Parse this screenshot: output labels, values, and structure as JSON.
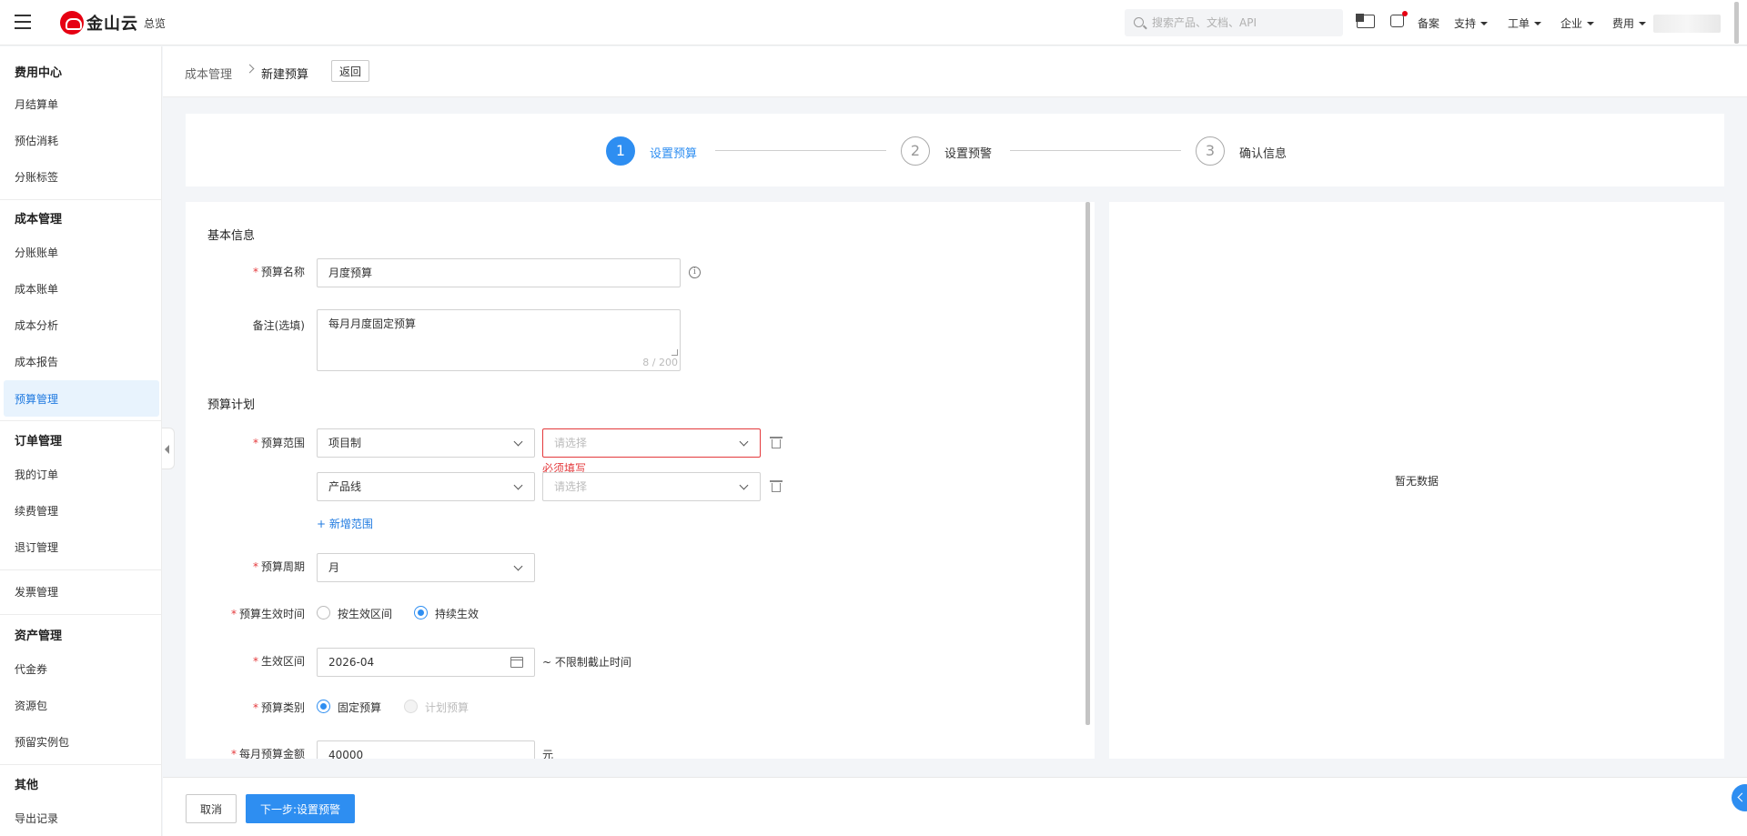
{
  "topbar": {
    "brand": "金山云",
    "overview": "总览",
    "search_placeholder": "搜索产品、文档、API",
    "nav": {
      "filing": "备案",
      "support": "支持",
      "ticket": "工单",
      "enterprise": "企业",
      "billing": "费用"
    }
  },
  "sidebar": {
    "groups": [
      {
        "title": "费用中心",
        "items": [
          "月结算单",
          "预估消耗",
          "分账标签"
        ]
      },
      {
        "title": "成本管理",
        "items": [
          "分账账单",
          "成本账单",
          "成本分析",
          "成本报告",
          "预算管理"
        ]
      },
      {
        "title": "订单管理",
        "items": [
          "我的订单",
          "续费管理",
          "退订管理"
        ]
      },
      {
        "title": "",
        "items": [
          "发票管理"
        ]
      },
      {
        "title": "资产管理",
        "items": [
          "代金券",
          "资源包",
          "预留实例包"
        ]
      },
      {
        "title": "其他",
        "items": [
          "导出记录"
        ]
      }
    ],
    "active": "预算管理"
  },
  "breadcrumb": {
    "parent": "成本管理",
    "current": "新建预算",
    "back_label": "返回"
  },
  "steps": [
    {
      "num": "1",
      "label": "设置预算",
      "status": "active"
    },
    {
      "num": "2",
      "label": "设置预警",
      "status": "wait"
    },
    {
      "num": "3",
      "label": "确认信息",
      "status": "wait"
    }
  ],
  "form": {
    "basic_title": "基本信息",
    "name_label": "预算名称",
    "name_value": "月度预算",
    "remark_label": "备注(选填)",
    "remark_value": "每月月度固定预算",
    "remark_counter": "8 / 200",
    "plan_title": "预算计划",
    "scope_label": "预算范围",
    "scope_rows": [
      {
        "type": "项目制",
        "value_placeholder": "请选择",
        "error": "必须填写"
      },
      {
        "type": "产品线",
        "value_placeholder": "请选择",
        "error": ""
      }
    ],
    "add_scope": "+ 新增范围",
    "period_label": "预算周期",
    "period_value": "月",
    "effect_label": "预算生效时间",
    "effect_options": [
      "按生效区间",
      "持续生效"
    ],
    "effect_selected": "持续生效",
    "range_label": "生效区间",
    "range_value": "2026-04",
    "range_suffix": "~ 不限制截止时间",
    "type_label": "预算类别",
    "type_options": [
      "固定预算",
      "计划预算"
    ],
    "type_selected": "固定预算",
    "amount_label": "每月预算金额",
    "amount_value": "40000",
    "amount_unit": "元"
  },
  "right_panel": {
    "empty_text": "暂无数据"
  },
  "footer": {
    "cancel": "取消",
    "next": "下一步:设置预警"
  },
  "colors": {
    "primary": "#2e8ef1",
    "error": "#e4393c",
    "brand": "#e60012"
  }
}
